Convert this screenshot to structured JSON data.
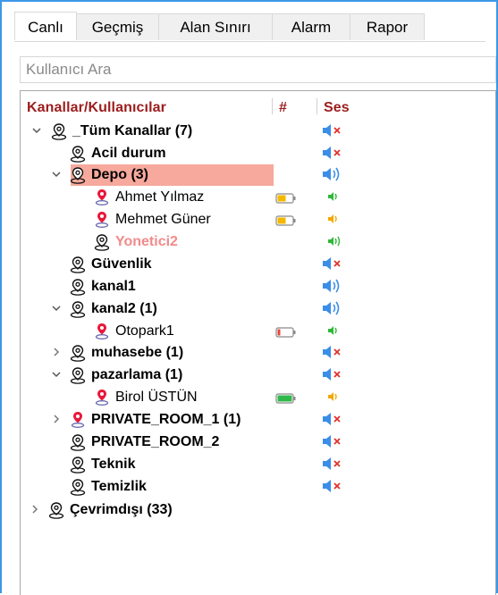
{
  "tabs": [
    {
      "label": "Canlı",
      "active": true
    },
    {
      "label": "Geçmiş",
      "active": false
    },
    {
      "label": "Alan Sınırı",
      "active": false
    },
    {
      "label": "Alarm",
      "active": false
    },
    {
      "label": "Rapor",
      "active": false
    }
  ],
  "search": {
    "placeholder": "Kullanıcı Ara"
  },
  "columns": {
    "name": "Kanallar/Kullanıcılar",
    "hash": "#",
    "sound": "Ses"
  },
  "colors": {
    "header": "#9c1c1c",
    "selected_row": "#f6a99c",
    "offline_user": "#f28a8a",
    "accent": "#3c97e8"
  },
  "tree": [
    {
      "label": "_Tüm Kanallar (7)",
      "type": "channel",
      "expander": "expanded",
      "sound": "speaker-muted"
    },
    {
      "label": "Acil durum",
      "type": "channel",
      "expander": "none",
      "sound": "speaker-muted"
    },
    {
      "label": "Depo (3)",
      "type": "channel",
      "expander": "expanded",
      "selected": true,
      "sound": "speaker-on"
    },
    {
      "label": "Ahmet Yılmaz",
      "type": "user",
      "battery": "medium",
      "sound": "small-speaker-green"
    },
    {
      "label": "Mehmet Güner",
      "type": "user",
      "battery": "medium",
      "sound": "small-speaker-yellow"
    },
    {
      "label": "Yonetici2",
      "type": "user-offline",
      "sound": "small-speaker-green-waves"
    },
    {
      "label": "Güvenlik",
      "type": "channel",
      "expander": "none",
      "sound": "speaker-muted"
    },
    {
      "label": "kanal1",
      "type": "channel",
      "expander": "none",
      "sound": "speaker-on"
    },
    {
      "label": "kanal2 (1)",
      "type": "channel",
      "expander": "expanded",
      "sound": "speaker-on"
    },
    {
      "label": "Otopark1",
      "type": "user",
      "battery": "low",
      "sound": "small-speaker-green"
    },
    {
      "label": "muhasebe (1)",
      "type": "channel",
      "expander": "collapsed",
      "sound": "speaker-muted"
    },
    {
      "label": "pazarlama (1)",
      "type": "channel",
      "expander": "expanded",
      "sound": "speaker-muted"
    },
    {
      "label": "Birol ÜSTÜN",
      "type": "user",
      "battery": "full",
      "sound": "small-speaker-yellow"
    },
    {
      "label": "PRIVATE_ROOM_1 (1)",
      "type": "channel-red",
      "expander": "collapsed",
      "sound": "speaker-muted"
    },
    {
      "label": "PRIVATE_ROOM_2",
      "type": "channel",
      "expander": "none",
      "sound": "speaker-muted"
    },
    {
      "label": "Teknik",
      "type": "channel",
      "expander": "none",
      "sound": "speaker-muted"
    },
    {
      "label": "Temizlik",
      "type": "channel",
      "expander": "none",
      "sound": "speaker-muted"
    },
    {
      "label": "Çevrimdışı (33)",
      "type": "channel",
      "expander": "collapsed",
      "sound": "none"
    }
  ]
}
